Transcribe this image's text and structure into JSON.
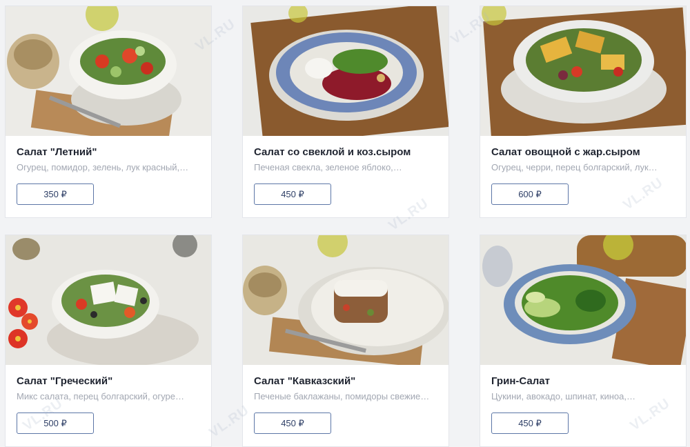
{
  "watermark": "VL.RU",
  "currency": "₽",
  "items": [
    {
      "title": "Салат \"Летний\"",
      "description": "Огурец, помидор, зелень, лук красный,…",
      "price": "350 ₽",
      "image": "summer-salad-photo"
    },
    {
      "title": "Салат со свеклой и коз.сыром",
      "description": "Печеная свекла, зеленое яблоко,…",
      "price": "450 ₽",
      "image": "beet-goat-cheese-salad-photo"
    },
    {
      "title": "Салат овощной с жар.сыром",
      "description": "Огурец, черри, перец болгарский, лук…",
      "price": "600 ₽",
      "image": "vegetable-fried-cheese-salad-photo"
    },
    {
      "title": "Салат \"Греческий\"",
      "description": "Микс салата, перец болгарский, огуре…",
      "price": "500 ₽",
      "image": "greek-salad-photo"
    },
    {
      "title": "Салат \"Кавказский\"",
      "description": "Печеные баклажаны, помидоры свежие…",
      "price": "450 ₽",
      "image": "caucasian-salad-photo"
    },
    {
      "title": "Грин-Салат",
      "description": "Цукини, авокадо, шпинат, киноа,…",
      "price": "450 ₽",
      "image": "green-salad-photo"
    }
  ]
}
